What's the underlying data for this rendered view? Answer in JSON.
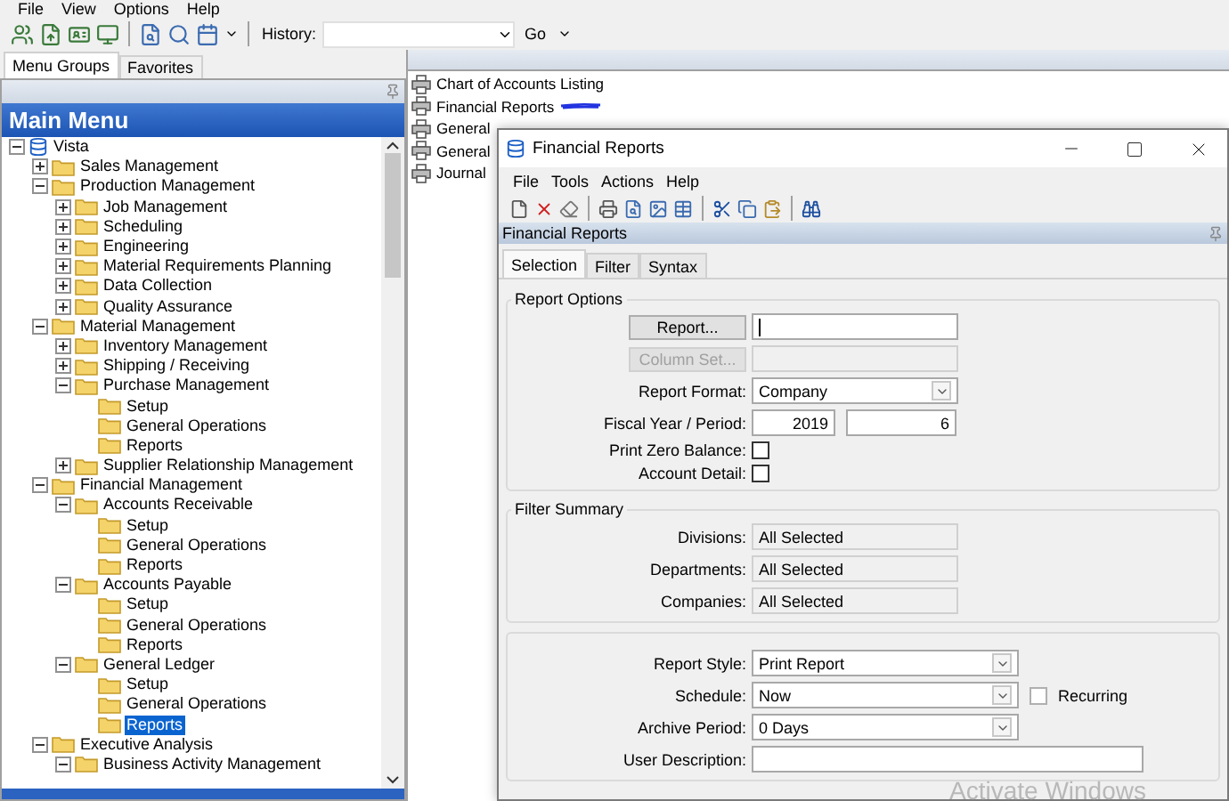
{
  "menu_bar": [
    "File",
    "View",
    "Options",
    "Help"
  ],
  "toolbar": {
    "history_label": "History:",
    "go_button": "Go"
  },
  "left_tabs": [
    {
      "label": "Menu Groups",
      "selected": true
    },
    {
      "label": "Favorites",
      "selected": false
    }
  ],
  "main_menu": {
    "title": "Main Menu",
    "tree": [
      {
        "kind": "root",
        "label": "Vista",
        "expanded": true,
        "selected": false,
        "children": [
          {
            "kind": "folder",
            "label": "Sales Management",
            "expanded": false,
            "selected": false
          },
          {
            "kind": "folder",
            "label": "Production Management",
            "expanded": true,
            "selected": false,
            "children": [
              {
                "kind": "folder",
                "label": "Job Management",
                "expanded": false,
                "selected": false
              },
              {
                "kind": "folder",
                "label": "Scheduling",
                "expanded": false,
                "selected": false
              },
              {
                "kind": "folder",
                "label": "Engineering",
                "expanded": false,
                "selected": false
              },
              {
                "kind": "folder",
                "label": "Material Requirements Planning",
                "expanded": false,
                "selected": false
              },
              {
                "kind": "folder",
                "label": "Data Collection",
                "expanded": false,
                "selected": false
              },
              {
                "kind": "folder",
                "label": "Quality Assurance",
                "expanded": false,
                "selected": false
              }
            ]
          },
          {
            "kind": "folder",
            "label": "Material Management",
            "expanded": true,
            "selected": false,
            "children": [
              {
                "kind": "folder",
                "label": "Inventory Management",
                "expanded": false,
                "selected": false
              },
              {
                "kind": "folder",
                "label": "Shipping / Receiving",
                "expanded": false,
                "selected": false
              },
              {
                "kind": "folder",
                "label": "Purchase Management",
                "expanded": true,
                "selected": false,
                "children": [
                  {
                    "kind": "folder",
                    "label": "Setup",
                    "selected": false
                  },
                  {
                    "kind": "folder",
                    "label": "General Operations",
                    "selected": false
                  },
                  {
                    "kind": "folder",
                    "label": "Reports",
                    "selected": false
                  }
                ]
              },
              {
                "kind": "folder",
                "label": "Supplier Relationship Management",
                "expanded": false,
                "selected": false
              }
            ]
          },
          {
            "kind": "folder",
            "label": "Financial Management",
            "expanded": true,
            "selected": false,
            "children": [
              {
                "kind": "folder",
                "label": "Accounts Receivable",
                "expanded": true,
                "selected": false,
                "children": [
                  {
                    "kind": "folder",
                    "label": "Setup",
                    "selected": false
                  },
                  {
                    "kind": "folder",
                    "label": "General Operations",
                    "selected": false
                  },
                  {
                    "kind": "folder",
                    "label": "Reports",
                    "selected": false
                  }
                ]
              },
              {
                "kind": "folder",
                "label": "Accounts Payable",
                "expanded": true,
                "selected": false,
                "children": [
                  {
                    "kind": "folder",
                    "label": "Setup",
                    "selected": false
                  },
                  {
                    "kind": "folder",
                    "label": "General Operations",
                    "selected": false
                  },
                  {
                    "kind": "folder",
                    "label": "Reports",
                    "selected": false
                  }
                ]
              },
              {
                "kind": "folder",
                "label": "General Ledger",
                "expanded": true,
                "selected": false,
                "children": [
                  {
                    "kind": "folder",
                    "label": "Setup",
                    "selected": false
                  },
                  {
                    "kind": "folder",
                    "label": "General Operations",
                    "selected": false
                  },
                  {
                    "kind": "folder",
                    "label": "Reports",
                    "selected": true
                  }
                ]
              }
            ]
          },
          {
            "kind": "folder",
            "label": "Executive Analysis",
            "expanded": true,
            "selected": false,
            "children": [
              {
                "kind": "folder",
                "label": "Business Activity Management",
                "expanded": true,
                "selected": false
              }
            ]
          }
        ]
      }
    ]
  },
  "report_list": [
    {
      "label": "Chart of Accounts Listing",
      "marked": false
    },
    {
      "label": "Financial Reports",
      "marked": true
    },
    {
      "label": "General",
      "marked": false
    },
    {
      "label": "General",
      "marked": false
    },
    {
      "label": "Journal",
      "marked": false
    }
  ],
  "dialog": {
    "title": "Financial Reports",
    "menu": [
      "File",
      "Tools",
      "Actions",
      "Help"
    ],
    "header": "Financial Reports",
    "tabs": [
      {
        "label": "Selection",
        "selected": true
      },
      {
        "label": "Filter",
        "selected": false
      },
      {
        "label": "Syntax",
        "selected": false
      }
    ],
    "groups": [
      {
        "title": "Report Options",
        "rows": [
          {
            "kind": "button_input",
            "button": "Report...",
            "disabled": false,
            "focused": true
          },
          {
            "kind": "button_input",
            "button": "Column Set...",
            "disabled": true,
            "focused": false
          },
          {
            "kind": "select",
            "label": "Report Format:",
            "value": "Company"
          },
          {
            "kind": "pair",
            "label": "Fiscal Year / Period:",
            "values": [
              "2019",
              "6"
            ]
          },
          {
            "kind": "checkbox",
            "label": "Print Zero Balance:",
            "checked": false
          },
          {
            "kind": "checkbox",
            "label": "Account Detail:",
            "checked": false
          }
        ]
      },
      {
        "title": "Filter Summary",
        "rows": [
          {
            "kind": "readonly",
            "label": "Divisions:",
            "value": "All Selected"
          },
          {
            "kind": "readonly",
            "label": "Departments:",
            "value": "All Selected"
          },
          {
            "kind": "readonly",
            "label": "Companies:",
            "value": "All Selected"
          }
        ]
      },
      {
        "rows": [
          {
            "kind": "select",
            "label": "Report Style:",
            "value": "Print Report"
          },
          {
            "kind": "select",
            "label": "Schedule:",
            "value": "Now",
            "checkbox": {
              "label": "Recurring",
              "checked": false
            }
          },
          {
            "kind": "select",
            "label": "Archive Period:",
            "value": "0 Days"
          },
          {
            "kind": "text",
            "label": "User Description:"
          }
        ]
      }
    ]
  },
  "os_notice": "Activate Windows"
}
